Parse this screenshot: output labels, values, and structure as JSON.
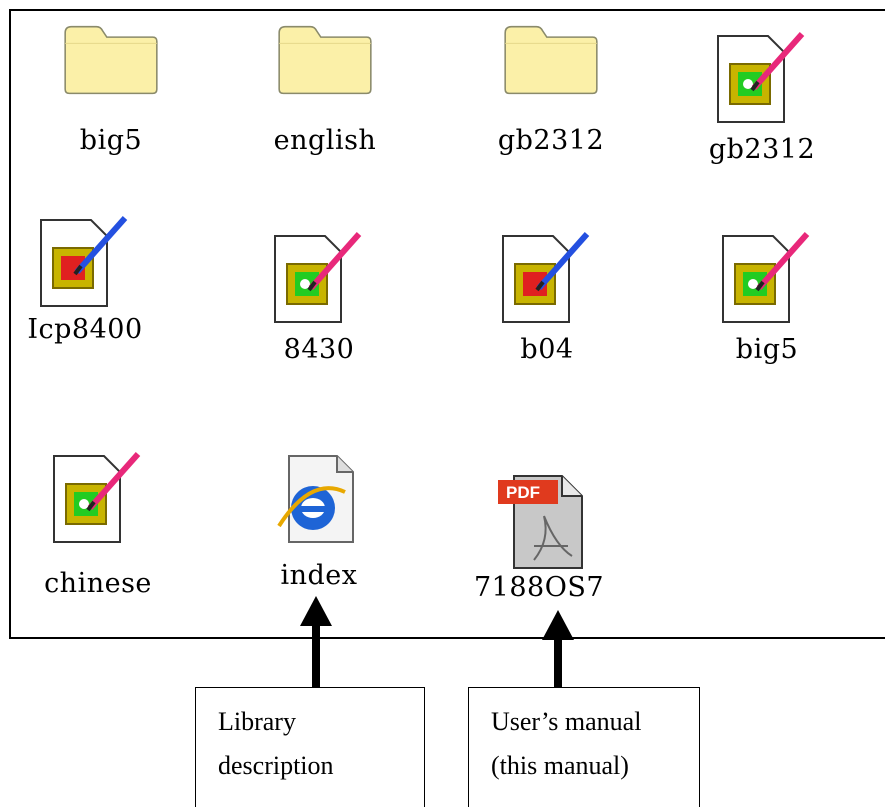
{
  "files": [
    {
      "label": "big5",
      "type": "folder"
    },
    {
      "label": "english",
      "type": "folder"
    },
    {
      "label": "gb2312",
      "type": "folder"
    },
    {
      "label": "gb2312",
      "type": "picture-green"
    },
    {
      "label": "Icp8400",
      "type": "picture-red"
    },
    {
      "label": "8430",
      "type": "picture-green"
    },
    {
      "label": "b04",
      "type": "picture-red"
    },
    {
      "label": "big5",
      "type": "picture-green"
    },
    {
      "label": "chinese",
      "type": "picture-green"
    },
    {
      "label": "index",
      "type": "html-document"
    },
    {
      "label": "7188OS7",
      "type": "pdf-document"
    }
  ],
  "callouts": {
    "library": {
      "line1": "Library",
      "line2": "description"
    },
    "manual": {
      "line1": "User’s manual",
      "line2": "(this manual)"
    }
  },
  "icons": {
    "folder": "folder-icon",
    "picture": "picture-file-icon",
    "html": "internet-explorer-document-icon",
    "pdf": "pdf-document-icon"
  },
  "colors": {
    "folder_fill": "#FBF0A8",
    "folder_stroke": "#8A8A6A",
    "frame_gold": "#C8B400",
    "pencil_pink": "#E8287A",
    "pencil_blue": "#2450E0",
    "pdf_red": "#E03A1E",
    "ie_blue": "#1E64D6"
  }
}
